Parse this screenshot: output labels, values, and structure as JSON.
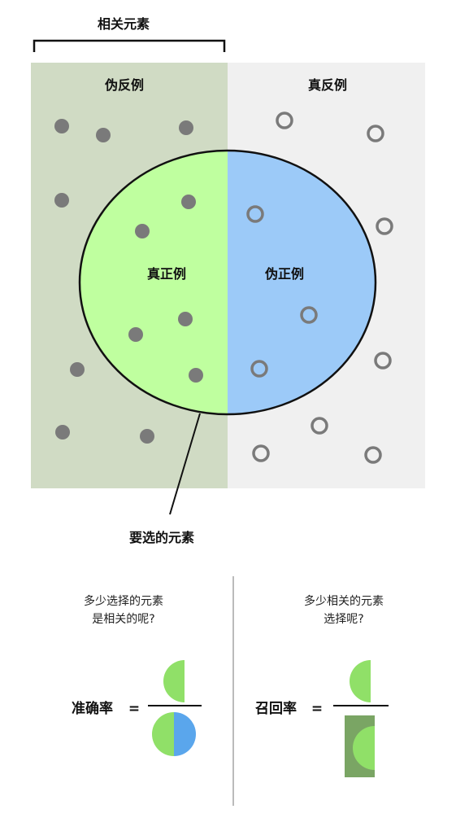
{
  "top": {
    "relevant_bracket_label": "相关元素",
    "false_negatives_label": "伪反例",
    "true_negatives_label": "真反例",
    "true_positives_label": "真正例",
    "false_positives_label": "伪正例",
    "selected_label": "要选的元素"
  },
  "precision": {
    "question_line1": "多少选择的元素",
    "question_line2": "是相关的呢?",
    "name": "准确率",
    "equals": "="
  },
  "recall": {
    "question_line1": "多少相关的元素",
    "question_line2": "选择呢?",
    "name": "召回率",
    "equals": "="
  },
  "colors": {
    "relevant_bg": "#d0dbc4",
    "irrelevant_bg": "#f0f0f0",
    "true_positive_fill": "#bfff9f",
    "false_positive_fill": "#9ccaf8",
    "dot_color": "#7a7a7a",
    "accent_green": "#90e068",
    "accent_blue": "#5aa6ec",
    "dark_green": "#7aa564"
  }
}
